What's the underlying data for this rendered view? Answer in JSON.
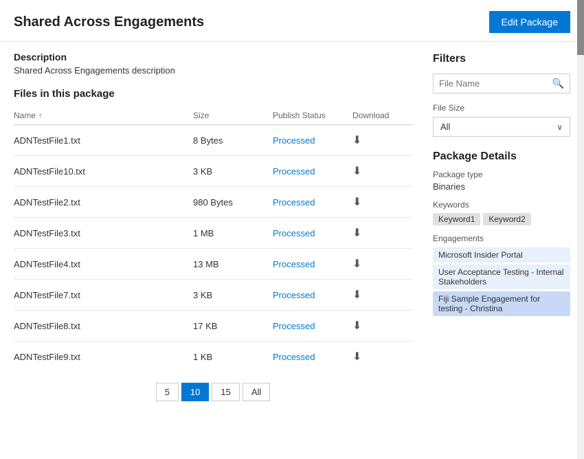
{
  "header": {
    "title": "Shared Across Engagements",
    "edit_button_label": "Edit Package"
  },
  "description": {
    "label": "Description",
    "text": "Shared Across Engagements description"
  },
  "files_section": {
    "title": "Files in this package",
    "columns": {
      "name": "Name",
      "size": "Size",
      "publish_status": "Publish Status",
      "download": "Download"
    },
    "rows": [
      {
        "name": "ADNTestFile1.txt",
        "size": "8 Bytes",
        "status": "Processed"
      },
      {
        "name": "ADNTestFile10.txt",
        "size": "3 KB",
        "status": "Processed"
      },
      {
        "name": "ADNTestFile2.txt",
        "size": "980 Bytes",
        "status": "Processed"
      },
      {
        "name": "ADNTestFile3.txt",
        "size": "1 MB",
        "status": "Processed"
      },
      {
        "name": "ADNTestFile4.txt",
        "size": "13 MB",
        "status": "Processed"
      },
      {
        "name": "ADNTestFile7.txt",
        "size": "3 KB",
        "status": "Processed"
      },
      {
        "name": "ADNTestFile8.txt",
        "size": "17 KB",
        "status": "Processed"
      },
      {
        "name": "ADNTestFile9.txt",
        "size": "1 KB",
        "status": "Processed"
      }
    ]
  },
  "pagination": {
    "pages": [
      "5",
      "10",
      "15",
      "All"
    ],
    "active": "10"
  },
  "filters": {
    "title": "Filters",
    "search_placeholder": "File Name",
    "file_size_label": "File Size",
    "file_size_value": "All"
  },
  "package_details": {
    "title": "Package Details",
    "package_type_label": "Package type",
    "package_type_value": "Binaries",
    "keywords_label": "Keywords",
    "keywords": [
      "Keyword1",
      "Keyword2"
    ],
    "engagements_label": "Engagements",
    "engagements": [
      {
        "name": "Microsoft Insider Portal",
        "highlight": false
      },
      {
        "name": "User Acceptance Testing - Internal Stakeholders",
        "highlight": false
      },
      {
        "name": "Fiji Sample Engagement for testing - Christina",
        "highlight": true
      }
    ]
  },
  "icons": {
    "search": "🔍",
    "download": "⬇",
    "sort_asc": "↑",
    "chevron_down": "∨"
  }
}
